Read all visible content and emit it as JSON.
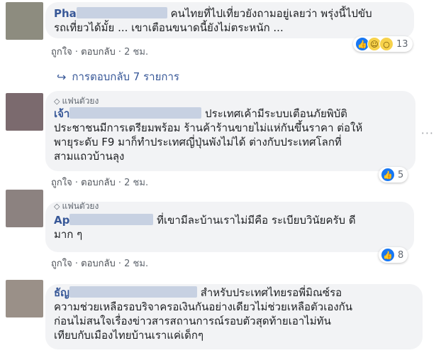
{
  "comments": [
    {
      "author": "Pha",
      "fan_badge": "",
      "body": "คนไทยที่ไปเที่ยวยังถามอยู่เลยว่า พรุ่งนี้ไปขับ\nรถเที่ยวได้มั้ย ... เขาเตือนขนาดนี้ยังไม่ตระหนัก ...",
      "like_label": "ถูกใจ",
      "reply_label": "ตอบกลับ",
      "time": "2 ชม.",
      "reaction_count": "13",
      "reaction_icons": [
        "like-icon",
        "haha-icon",
        "wow-icon"
      ]
    },
    {
      "author": "เจ้า",
      "fan_badge": "แฟนตัวยง",
      "body": "ประเทศเค้ามีระบบเตือนภัยพิบัติ\nประชาชนมีการเตรียมพร้อม ร้านค้าร้านขายไม่แห่กันขึ้นราคา ต่อให้\nพายุระดับ F9 มาก็ทำประเทศญี่ปุ่นพังไม่ได้ ต่างกับประเทศโลกที่\nสามแถวบ้านลุง",
      "like_label": "ถูกใจ",
      "reply_label": "ตอบกลับ",
      "time": "2 ชม.",
      "reaction_count": "5",
      "reaction_icons": [
        "like-icon"
      ]
    },
    {
      "author": "Ap",
      "fan_badge": "แฟนตัวยง",
      "body": "ที่เขามีละบ้านเราไม่มีคือ ระเบียบวินัยครับ ดี\nมาก ๆ",
      "like_label": "ถูกใจ",
      "reply_label": "ตอบกลับ",
      "time": "2 ชม.",
      "reaction_count": "8",
      "reaction_icons": [
        "like-icon"
      ]
    },
    {
      "author": "ธัญ",
      "fan_badge": "",
      "body": "สำหรับประเทศไทยรอพี่มิณซ์รอ\nความช่วยเหลือรอบริจาครอเงินกันอย่างเดียวไม่ช่วยเหลือตัวเองกัน\nก่อนไม่สนใจเรื่องข่าวสารสถานการณ์รอบตัวสุดท้ายเอาไม่ทัน\nเทียบกับเมืองไทยบ้านเราแค่เด็กๆ",
      "like_label": "",
      "reply_label": "",
      "time": "",
      "reaction_count": "",
      "reaction_icons": []
    }
  ],
  "replies_link": "การตอบกลับ 7 รายการ",
  "separator": "·",
  "colors": {
    "link": "#385898",
    "like": "#1877f2",
    "bubble": "#f2f3f5"
  }
}
